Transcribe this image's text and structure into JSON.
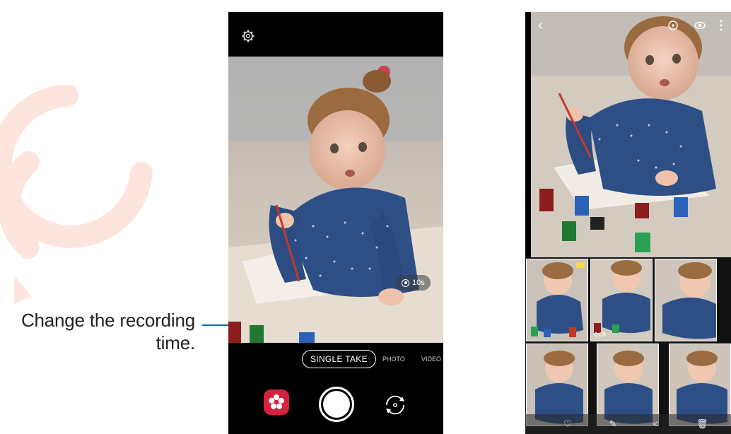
{
  "callout": {
    "text_line1": "Change the recording",
    "text_line2": "time."
  },
  "camera": {
    "settings_icon": "gear-icon",
    "timer_label": "10s",
    "modes": {
      "single_take": "SINGLE TAKE",
      "photo": "PHOTO",
      "video": "VIDEO"
    },
    "effects_icon": "flower-effects-icon",
    "shutter_icon": "shutter-button",
    "switch_icon": "switch-camera-icon"
  },
  "gallery": {
    "top_icons": [
      "back-icon",
      "rotate-icon",
      "eye-icon",
      "more-icon"
    ],
    "thumb_times": [
      "",
      "0:09",
      "",
      "",
      "",
      ""
    ],
    "bottom_icons": [
      "heart-icon",
      "edit-icon",
      "share-icon",
      "delete-icon"
    ]
  },
  "colors": {
    "accent_line": "#1a6aa5",
    "effects_red": "#d5223e",
    "watermark": "#fbe3dc"
  }
}
